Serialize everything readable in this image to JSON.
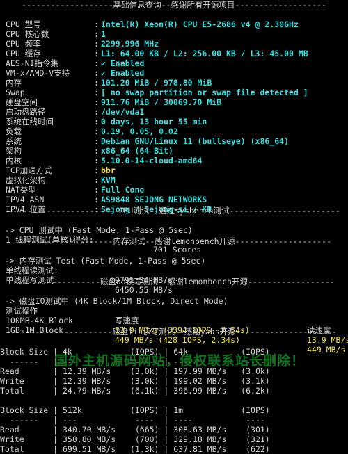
{
  "sysinfo": {
    "header": "-------------------基础信息查询--感谢所有开源项目-------------------",
    "rows": [
      {
        "key": "CPU 型号",
        "value": "Intel(R) Xeon(R) CPU E5-2686 v4 @ 2.30GHz"
      },
      {
        "key": "CPU 核心数",
        "value": "1"
      },
      {
        "key": "CPU 频率",
        "value": "2299.996 MHz"
      },
      {
        "key": "CPU 缓存",
        "value": "L1: 64.00 KB / L2: 256.00 KB / L3: 45.00 MB"
      },
      {
        "key": "AES-NI指令集",
        "value": "✔ Enabled"
      },
      {
        "key": "VM-x/AMD-V支持",
        "value": "✔ Enabled"
      },
      {
        "key": "内存",
        "value": "101.20 MiB / 978.80 MiB"
      },
      {
        "key": "Swap",
        "value": "[ no swap partition or swap file detected ]"
      },
      {
        "key": "硬盘空间",
        "value": "911.76 MiB / 30069.70 MiB"
      },
      {
        "key": "启动盘路径",
        "value": "/dev/vda1"
      },
      {
        "key": "系统在线时间",
        "value": "0 days, 13 hour 55 min"
      },
      {
        "key": "负载",
        "value": "0.19, 0.05, 0.02"
      },
      {
        "key": "系统",
        "value": "Debian GNU/Linux 11 (bullseye) (x86_64)"
      },
      {
        "key": "架构",
        "value": "x86_64 (64 Bit)"
      },
      {
        "key": "内核",
        "value": "5.10.0-14-cloud-amd64"
      },
      {
        "key": "TCP加速方式",
        "value": "bbr"
      },
      {
        "key": "虚拟化架构",
        "value": "KVM"
      },
      {
        "key": "NAT类型",
        "value": "Full Cone"
      },
      {
        "key": "IPV4 ASN",
        "value": "AS9848 SEJONG NETWORKS"
      },
      {
        "key": "IPV4 位置",
        "value": "Sejong / Sejong-si / KR"
      }
    ]
  },
  "cpu": {
    "header": "-----------------------CPU测试--通过sysbench测试-----------------------",
    "running": " -> CPU 测试中 (Fast Mode, 1-Pass @ 5sec)",
    "result_label": "1 线程测试(单核)得分:",
    "result_value": "701 Scores"
  },
  "memory": {
    "header": "--------------------内存测试--感谢lemonbench开源--------------------",
    "running": " -> 内存测试 Test (Fast Mode, 1-Pass @ 5sec)",
    "read_label": "单线程读测试:",
    "read_value": "9791.34 MB/s",
    "write_label": "单线程写测试:",
    "write_value": "6450.55 MB/s"
  },
  "disk_dd": {
    "header": "------------------磁盘dd读写测试--感谢lemonbench开源------------------",
    "running": " -> 磁盘IO测试中 (4K Block/1M Block, Direct Mode)",
    "col_op": "测试操作",
    "col_write": "写速度",
    "col_read": "读速度",
    "rows": [
      {
        "op": "100MB-4K Block",
        "write": "13.9 MB/s (3394 IOPS, 7.54s)",
        "read": "13.9 MB/s"
      },
      {
        "op": "1GB-1M Block",
        "write": "449 MB/s (428 IOPS, 2.34s)",
        "read": "449 MB/s"
      }
    ]
  },
  "fio": {
    "header": "---------------------磁盘fio读写测试--感谢yabs开源---------------------",
    "blocks": [
      {
        "head": "Block Size | 4k            (IOPS) | 64k           (IOPS)",
        "dash": "  ------   | ---            ----  | ----           ----",
        "rows": [
          "Read       | 12.39 MB/s    (3.0k) | 197.99 MB/s   (3.0k)",
          "Write      | 12.39 MB/s    (3.0k) | 199.02 MB/s   (3.1k)",
          "Total      | 24.79 MB/s    (6.1k) | 396.99 MB/s   (6.2k)"
        ]
      },
      {
        "head": "Block Size | 512k          (IOPS) | 1m            (IOPS)",
        "dash": "  ------   | ---            ----  | ----           ----",
        "rows": [
          "Read       | 340.70 MB/s    (665) | 308.63 MB/s    (301)",
          "Write      | 358.80 MB/s    (700) | 329.18 MB/s    (321)",
          "Total      | 699.51 MB/s   (1.3k) | 637.81 MB/s    (622)"
        ]
      }
    ]
  },
  "watermark": "国外主机源码网站，侵权联系站长删除！",
  "colors": {
    "value": "#38e0e0",
    "highlight": "#f2e14a",
    "text": "#d2d2d2",
    "background": "#000000"
  }
}
